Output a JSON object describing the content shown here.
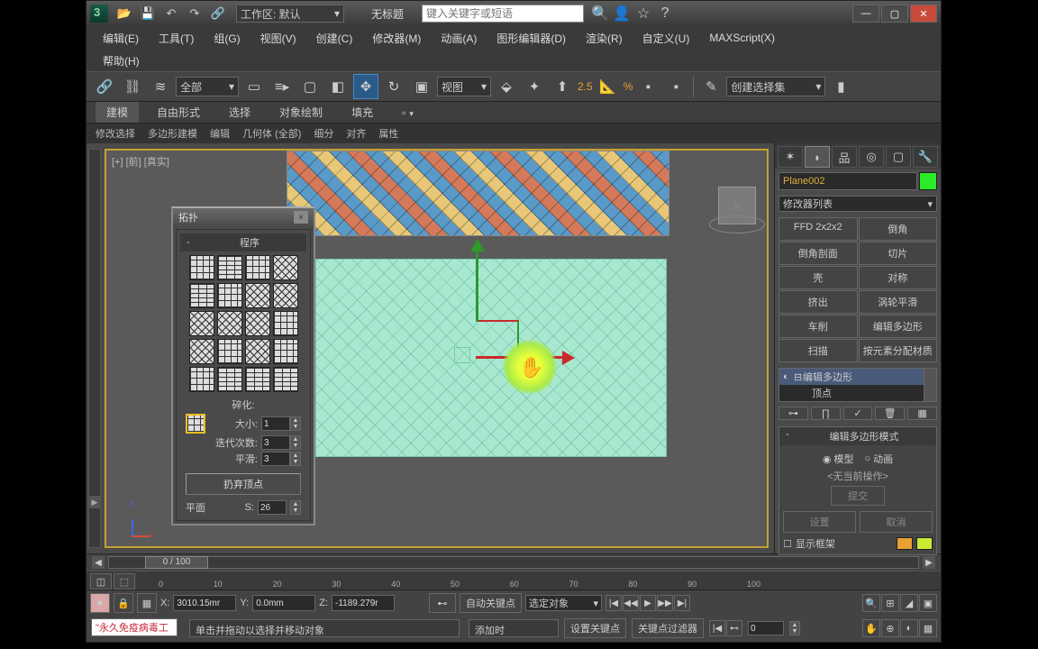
{
  "title": "无标题",
  "workspace_label": "工作区: 默认",
  "search_placeholder": "键入关键字或短语",
  "menus": [
    "编辑(E)",
    "工具(T)",
    "组(G)",
    "视图(V)",
    "创建(C)",
    "修改器(M)",
    "动画(A)",
    "图形编辑器(D)",
    "渲染(R)",
    "自定义(U)",
    "MAXScript(X)"
  ],
  "menus2": [
    "帮助(H)"
  ],
  "toolbar": {
    "filter": "全部",
    "refcoord": "视图",
    "snap_angle": "2.5",
    "snap_pct": "%",
    "named_sel": "创建选择集"
  },
  "ribbon_tabs": [
    "建模",
    "自由形式",
    "选择",
    "对象绘制",
    "填充"
  ],
  "ribbon_sub": [
    "修改选择",
    "多边形建模",
    "编辑",
    "几何体 (全部)",
    "细分",
    "对齐",
    "属性"
  ],
  "viewport_label": "[+] [前] [真实]",
  "topo": {
    "title": "拓扑",
    "section": "程序",
    "frag_label": "碎化:",
    "size_label": "大小:",
    "size_val": "1",
    "iter_label": "迭代次数:",
    "iter_val": "3",
    "smooth_label": "平滑:",
    "smooth_val": "3",
    "discard_btn": "扔弃顶点",
    "plane_label": "平面",
    "s_label": "S:",
    "s_val": "26"
  },
  "cmd": {
    "object_name": "Plane002",
    "modlist": "修改器列表",
    "buttons": [
      "FFD 2x2x2",
      "倒角",
      "倒角剖面",
      "切片",
      "壳",
      "对称",
      "挤出",
      "涡轮平滑",
      "车削",
      "编辑多边形",
      "扫描",
      "按元素分配材质"
    ],
    "stack_top": "编辑多边形",
    "stack_sub": "顶点",
    "rollout_title": "编辑多边形模式",
    "radio_model": "模型",
    "radio_anim": "动画",
    "no_op": "<无当前操作>",
    "commit": "提交",
    "settings": "设置",
    "cancel": "取消",
    "show_cage": "显示框架"
  },
  "timeslider": "0 / 100",
  "ruler_ticks": [
    "0",
    "10",
    "20",
    "30",
    "40",
    "50",
    "60",
    "70",
    "80",
    "90",
    "100"
  ],
  "coords": {
    "x": "3010.15mr",
    "y": "0.0mm",
    "z": "-1189.279r"
  },
  "autokey": "自动关键点",
  "setkey": "设置关键点",
  "keyfilter": "关键点过滤器",
  "sel_obj": "选定对象",
  "add_time": "添加时",
  "frame_field": "0",
  "status_msg": "单击并拖动以选择并移动对象",
  "script_input": "\"永久免疫病毒工"
}
